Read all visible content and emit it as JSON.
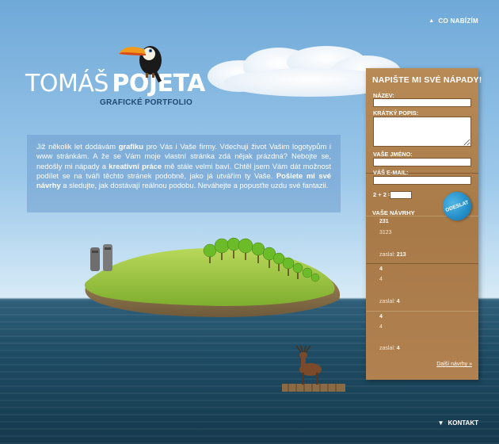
{
  "nav": {
    "top_label": "CO NABÍZÍM",
    "bottom_label": "KONTAKT"
  },
  "logo": {
    "first": "TOMÁŠ",
    "last": "POJETA",
    "subtitle": "GRAFICKÉ PORTFOLIO"
  },
  "intro": {
    "t1": "Již několik let dodávám ",
    "b1": "grafiku",
    "t2": " pro Vás i Vaše firmy. Vdechuji život Vašim logotypům i www stránkám. A že se Vám moje vlastní stránka zdá nějak prázdná? Nebojte se, nedošly mi nápady a ",
    "b2": "kreativní práce",
    "t3": " mě stále velmi baví. Chtěl jsem Vám dát možnost podílet se na tváři těchto stránek podobně, jako já utvářím ty Vaše. ",
    "b3": "Pošlete mi své návrhy",
    "t4": " a sledujte, jak dostávají reálnou podobu. Neváhejte a popusťte uzdu své fantazii."
  },
  "form": {
    "heading": "NAPIŠTE MI SVÉ NÁPADY!",
    "name_label": "NÁZEV:",
    "name_value": "",
    "desc_label": "KRÁTKÝ POPIS:",
    "desc_value": "",
    "author_label": "VAŠE JMÉNO:",
    "author_value": "",
    "email_label": "VÁŠ E-MAIL:",
    "email_value": "",
    "captcha_label": "2 + 2 =",
    "captcha_value": "",
    "submit_label": "ODESLAT"
  },
  "proposals": {
    "title": "VAŠE NÁVRHY",
    "sent_by_label": "zaslal:",
    "items": [
      {
        "title": "231",
        "text": "3123",
        "author": "213"
      },
      {
        "title": "4",
        "text": "4",
        "author": "4"
      },
      {
        "title": "4",
        "text": "4",
        "author": "4"
      }
    ],
    "more_label": "Další návrhy »"
  },
  "colors": {
    "panel": "#b18150",
    "send_button": "#1d86c2",
    "intro_box": "#6d9cce"
  }
}
